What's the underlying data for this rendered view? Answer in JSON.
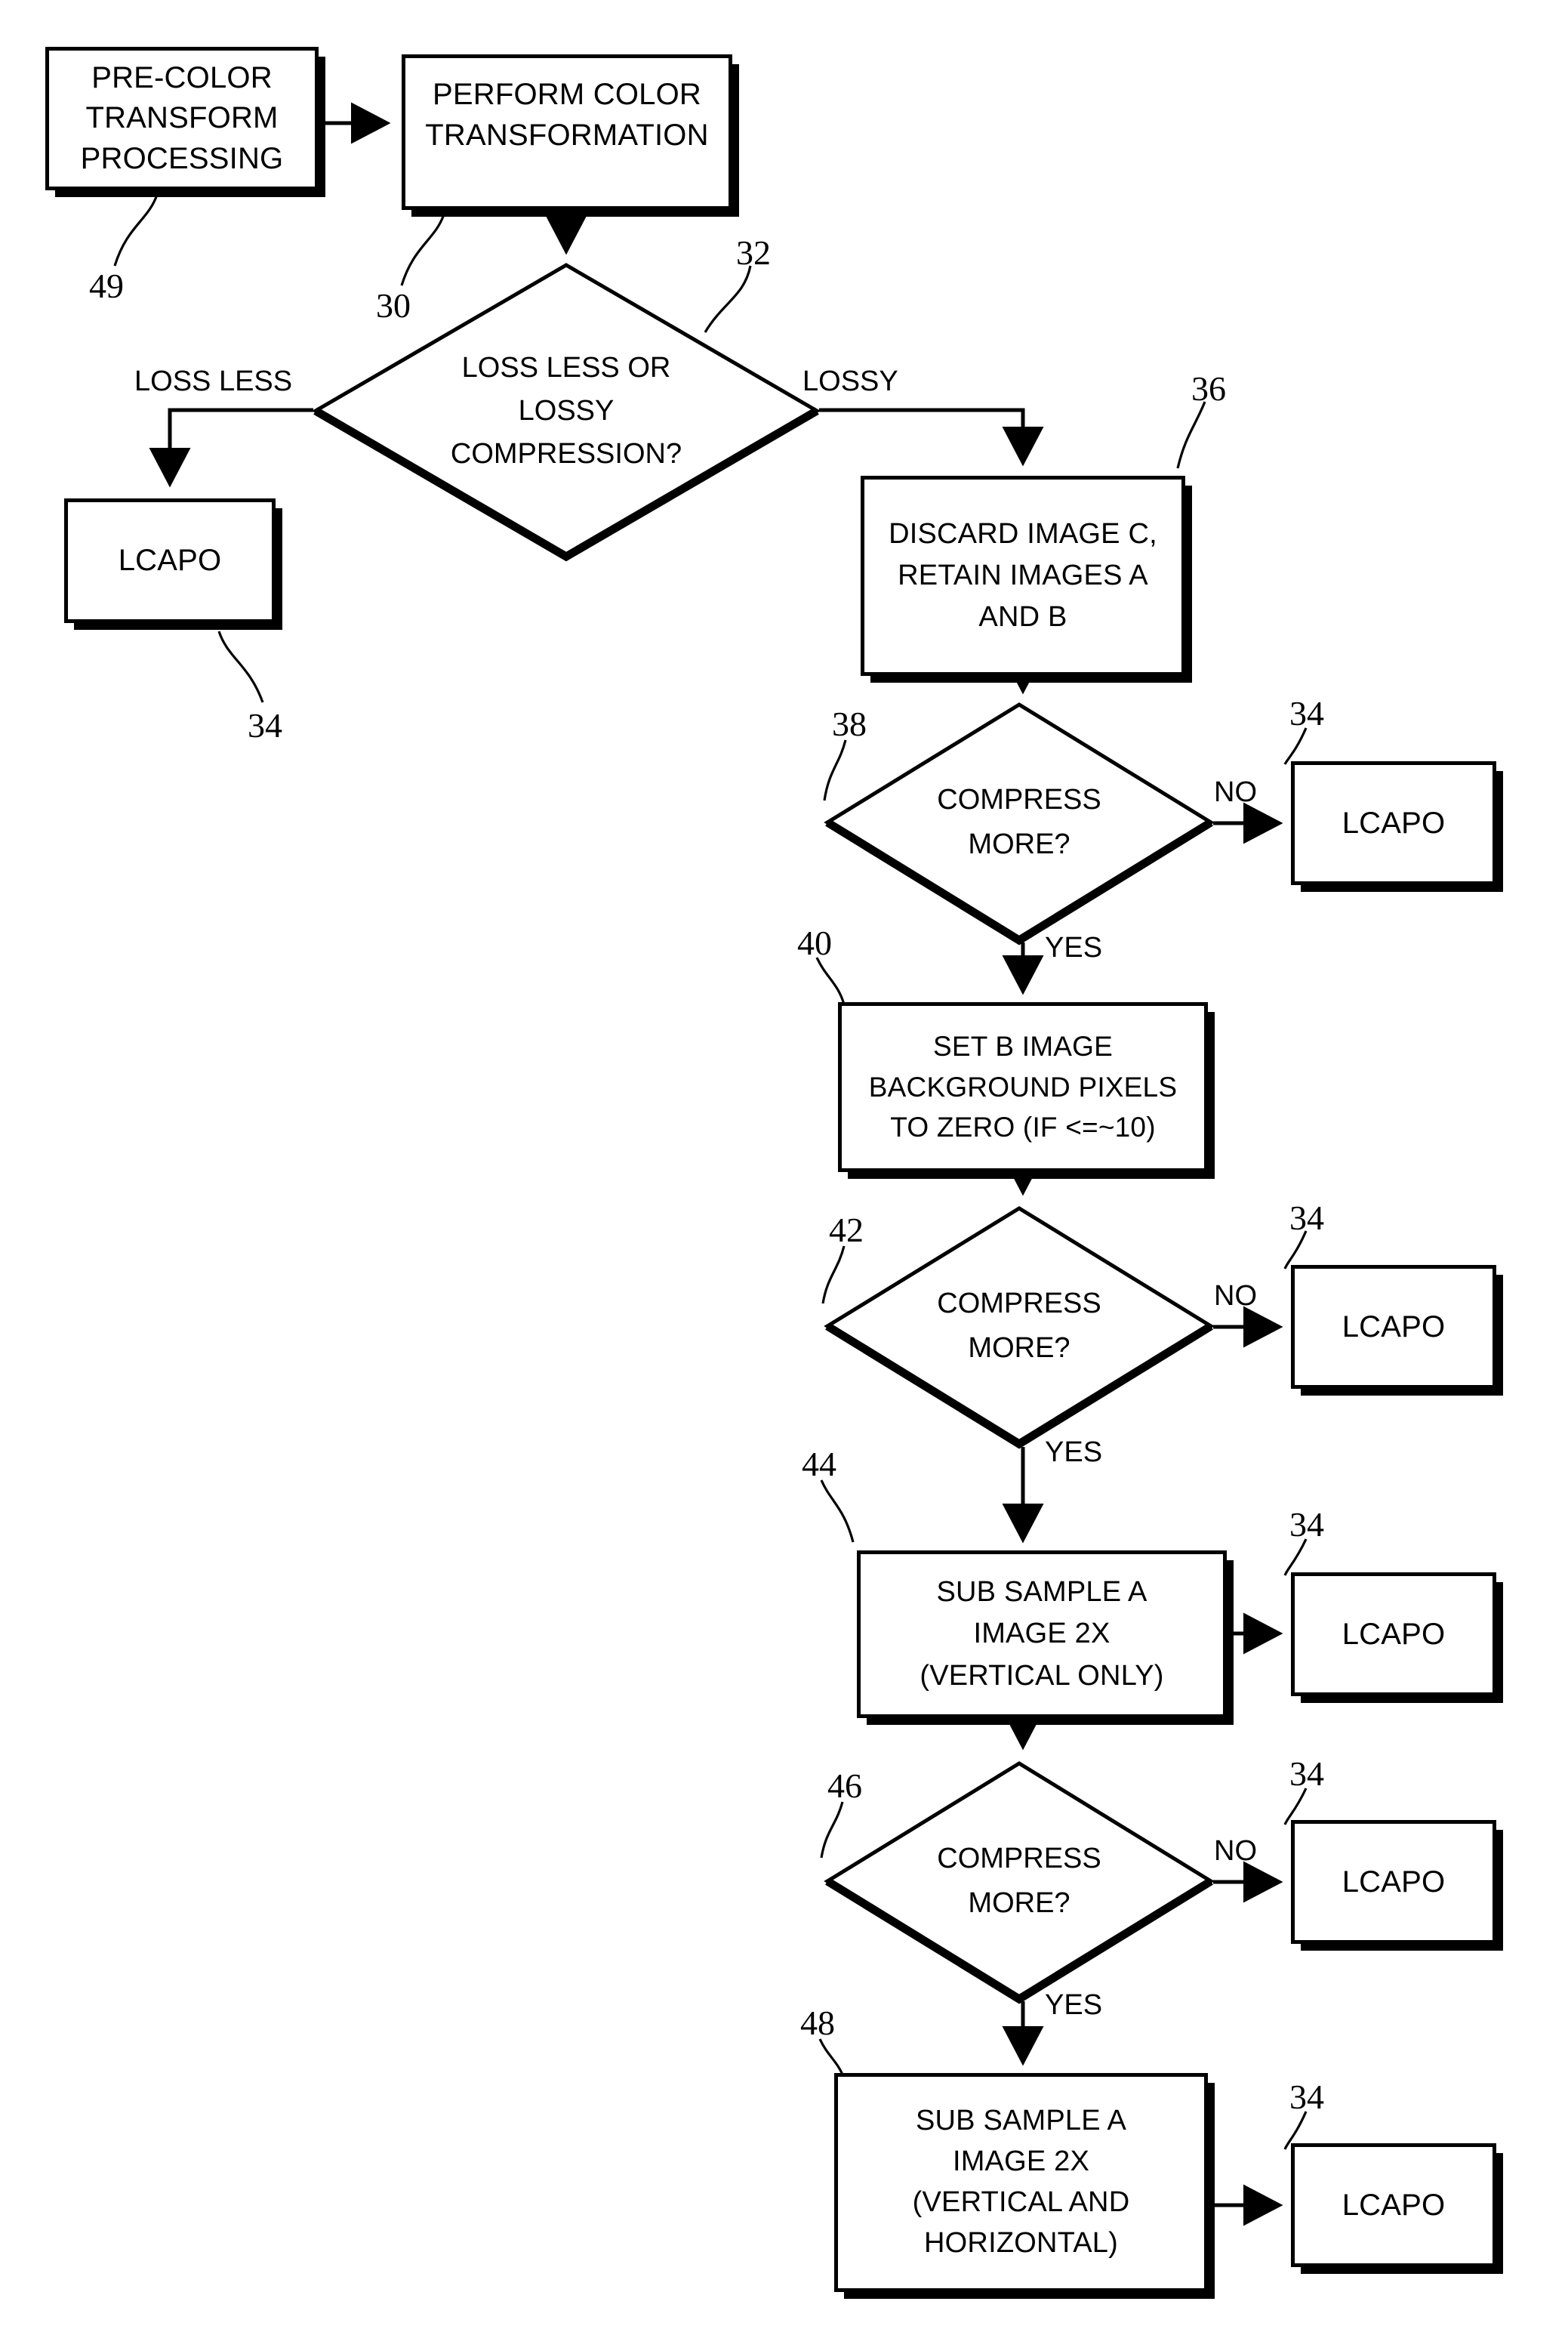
{
  "figure": {
    "type": "patent-flowchart",
    "background_color": "#ffffff",
    "line_color": "#000000"
  },
  "nodes": {
    "pre_color": {
      "ref": "49",
      "shape": "process",
      "lines": [
        "PRE-COLOR",
        "TRANSFORM",
        "PROCESSING"
      ]
    },
    "perform_color": {
      "ref": "30",
      "shape": "process",
      "lines": [
        "PERFORM COLOR",
        "TRANSFORMATION"
      ]
    },
    "decision_compression": {
      "ref": "32",
      "shape": "decision",
      "lines": [
        "LOSS LESS OR",
        "LOSSY",
        "COMPRESSION?"
      ]
    },
    "lcapo_lossless": {
      "ref": "34",
      "shape": "process",
      "lines": [
        "LCAPO"
      ]
    },
    "discard_image_c": {
      "ref": "36",
      "shape": "process",
      "lines": [
        "DISCARD IMAGE C,",
        "RETAIN IMAGES A",
        "AND B"
      ]
    },
    "decision_compress_1": {
      "ref": "38",
      "shape": "decision",
      "lines": [
        "COMPRESS",
        "MORE?"
      ]
    },
    "lcapo_1": {
      "ref": "34",
      "shape": "process",
      "lines": [
        "LCAPO"
      ]
    },
    "set_b_image": {
      "ref": "40",
      "shape": "process",
      "lines": [
        "SET B IMAGE",
        "BACKGROUND PIXELS",
        "TO ZERO (IF <=~10)"
      ]
    },
    "decision_compress_2": {
      "ref": "42",
      "shape": "decision",
      "lines": [
        "COMPRESS",
        "MORE?"
      ]
    },
    "lcapo_2": {
      "ref": "34",
      "shape": "process",
      "lines": [
        "LCAPO"
      ]
    },
    "sub_sample_vertical": {
      "ref": "44",
      "shape": "process",
      "lines": [
        "SUB SAMPLE A",
        "IMAGE 2X",
        "(VERTICAL ONLY)"
      ]
    },
    "lcapo_3": {
      "ref": "34",
      "shape": "process",
      "lines": [
        "LCAPO"
      ]
    },
    "decision_compress_3": {
      "ref": "46",
      "shape": "decision",
      "lines": [
        "COMPRESS",
        "MORE?"
      ]
    },
    "lcapo_4": {
      "ref": "34",
      "shape": "process",
      "lines": [
        "LCAPO"
      ]
    },
    "sub_sample_both": {
      "ref": "48",
      "shape": "process",
      "lines": [
        "SUB SAMPLE A",
        "IMAGE 2X",
        "(VERTICAL AND",
        "HORIZONTAL)"
      ]
    },
    "lcapo_5": {
      "ref": "34",
      "shape": "process",
      "lines": [
        "LCAPO"
      ]
    }
  },
  "edge_labels": {
    "loss_less": "LOSS LESS",
    "lossy": "LOSSY",
    "no_1": "NO",
    "yes_1": "YES",
    "no_2": "NO",
    "yes_2": "YES",
    "no_3": "NO",
    "yes_3": "YES"
  },
  "reference_numerals": {
    "n49": "49",
    "n30": "30",
    "n32": "32",
    "n34_lossless": "34",
    "n36": "36",
    "n38": "38",
    "n34_a": "34",
    "n40": "40",
    "n42": "42",
    "n34_b": "34",
    "n44": "44",
    "n34_c": "34",
    "n46": "46",
    "n34_d": "34",
    "n48": "48",
    "n34_e": "34"
  }
}
